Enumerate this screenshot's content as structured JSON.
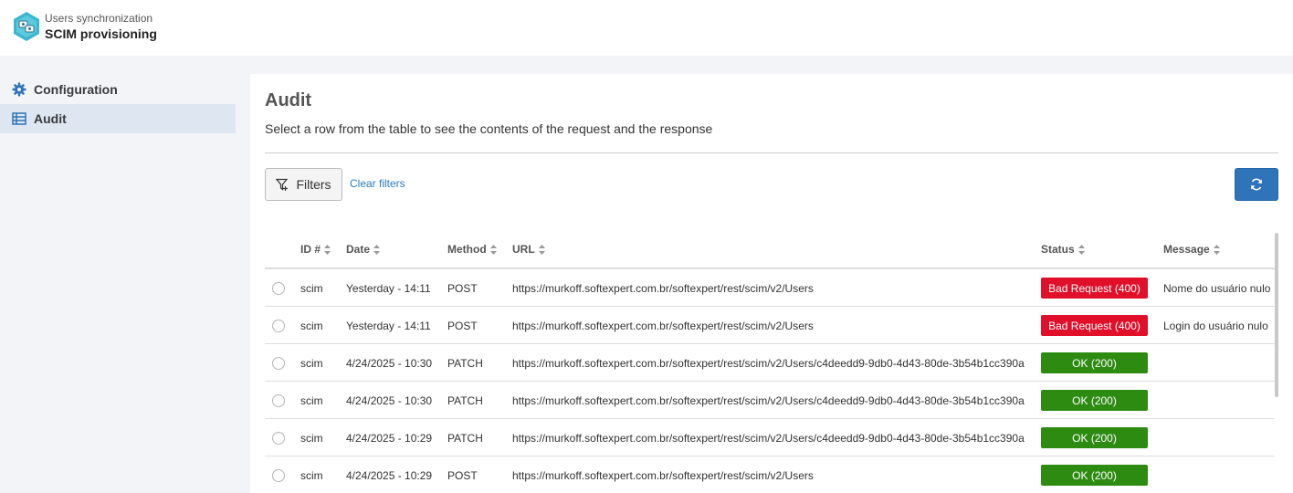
{
  "header": {
    "subtitle": "Users synchronization",
    "title": "SCIM provisioning"
  },
  "sidebar": {
    "items": [
      {
        "label": "Configuration",
        "icon": "gear-icon",
        "active": false
      },
      {
        "label": "Audit",
        "icon": "table-icon",
        "active": true
      }
    ]
  },
  "main": {
    "title": "Audit",
    "description": "Select a row from the table to see the contents of the request and the response",
    "filters_label": "Filters",
    "clear_filters_label": "Clear filters"
  },
  "table": {
    "columns": [
      "ID #",
      "Date",
      "Method",
      "URL",
      "Status",
      "Message"
    ],
    "rows": [
      {
        "id": "scim",
        "date": "Yesterday - 14:11",
        "method": "POST",
        "url": "https://murkoff.softexpert.com.br/softexpert/rest/scim/v2/Users",
        "status": "Bad Request (400)",
        "status_type": "bad",
        "message": "Nome do usuário nulo"
      },
      {
        "id": "scim",
        "date": "Yesterday - 14:11",
        "method": "POST",
        "url": "https://murkoff.softexpert.com.br/softexpert/rest/scim/v2/Users",
        "status": "Bad Request (400)",
        "status_type": "bad",
        "message": "Login do usuário nulo"
      },
      {
        "id": "scim",
        "date": "4/24/2025 - 10:30",
        "method": "PATCH",
        "url": "https://murkoff.softexpert.com.br/softexpert/rest/scim/v2/Users/c4deedd9-9db0-4d43-80de-3b54b1cc390a",
        "status": "OK (200)",
        "status_type": "ok",
        "message": ""
      },
      {
        "id": "scim",
        "date": "4/24/2025 - 10:30",
        "method": "PATCH",
        "url": "https://murkoff.softexpert.com.br/softexpert/rest/scim/v2/Users/c4deedd9-9db0-4d43-80de-3b54b1cc390a",
        "status": "OK (200)",
        "status_type": "ok",
        "message": ""
      },
      {
        "id": "scim",
        "date": "4/24/2025 - 10:29",
        "method": "PATCH",
        "url": "https://murkoff.softexpert.com.br/softexpert/rest/scim/v2/Users/c4deedd9-9db0-4d43-80de-3b54b1cc390a",
        "status": "OK (200)",
        "status_type": "ok",
        "message": ""
      },
      {
        "id": "scim",
        "date": "4/24/2025 - 10:29",
        "method": "POST",
        "url": "https://murkoff.softexpert.com.br/softexpert/rest/scim/v2/Users",
        "status": "OK (200)",
        "status_type": "ok",
        "message": ""
      }
    ]
  },
  "colors": {
    "accent": "#2f73b8",
    "bad": "#e0102b",
    "ok": "#2e8b12",
    "link": "#2a7bc0"
  }
}
